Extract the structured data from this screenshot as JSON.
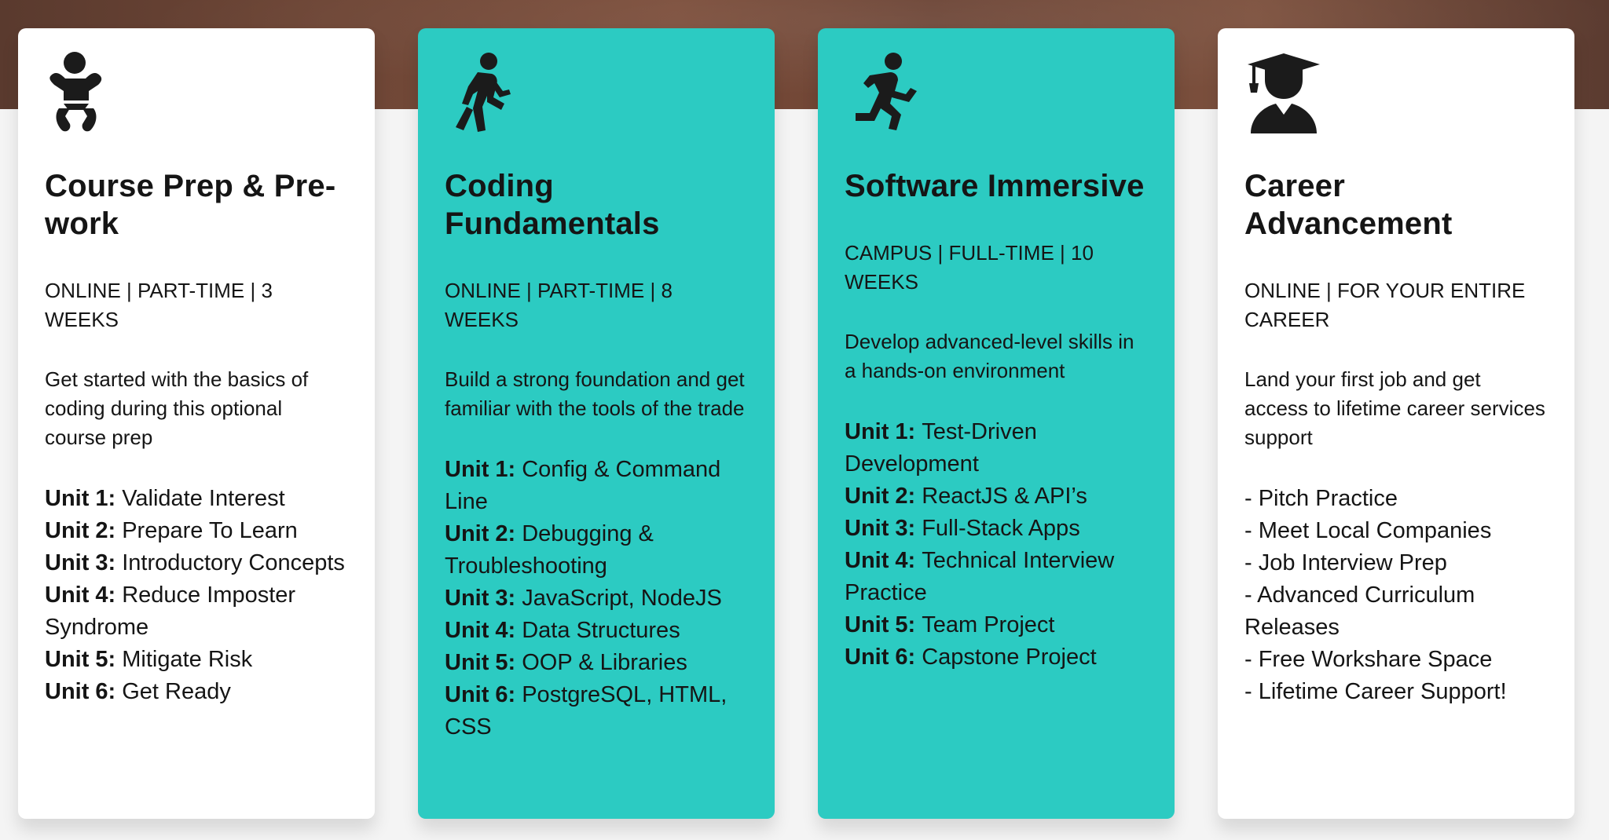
{
  "cards": [
    {
      "icon": "baby-icon",
      "title": "Course Prep & Pre-work",
      "meta": "ONLINE | PART-TIME | 3 WEEKS",
      "description": "Get started with the basics of coding during this optional course prep",
      "units": [
        {
          "label": "Unit 1:",
          "text": "Validate Interest"
        },
        {
          "label": "Unit 2:",
          "text": "Prepare To Learn"
        },
        {
          "label": "Unit 3:",
          "text": "Introductory Concepts"
        },
        {
          "label": "Unit 4:",
          "text": "Reduce Imposter Syndrome"
        },
        {
          "label": "Unit 5:",
          "text": "Mitigate Risk"
        },
        {
          "label": "Unit 6:",
          "text": "Get Ready"
        }
      ]
    },
    {
      "icon": "walking-icon",
      "title": "Coding Fundamentals",
      "meta": "ONLINE | PART-TIME | 8 WEEKS",
      "description": "Build a strong foundation and get familiar with the tools of the trade",
      "units": [
        {
          "label": "Unit 1:",
          "text": "Config & Command Line"
        },
        {
          "label": "Unit 2:",
          "text": "Debugging & Troubleshooting"
        },
        {
          "label": "Unit 3:",
          "text": "JavaScript, NodeJS"
        },
        {
          "label": "Unit 4:",
          "text": "Data Structures"
        },
        {
          "label": "Unit 5:",
          "text": "OOP & Libraries"
        },
        {
          "label": "Unit 6:",
          "text": "PostgreSQL, HTML, CSS"
        }
      ]
    },
    {
      "icon": "running-icon",
      "title": "Software Immersive",
      "meta": "CAMPUS | FULL-TIME | 10 WEEKS",
      "description": "Develop advanced-level skills in a hands-on environment",
      "units": [
        {
          "label": "Unit 1:",
          "text": "Test-Driven Development"
        },
        {
          "label": "Unit 2:",
          "text": "ReactJS & API’s"
        },
        {
          "label": "Unit 3:",
          "text": "Full-Stack Apps"
        },
        {
          "label": "Unit 4:",
          "text": "Technical Interview Practice"
        },
        {
          "label": "Unit 5:",
          "text": "Team Project"
        },
        {
          "label": "Unit 6:",
          "text": "Capstone Project"
        }
      ]
    },
    {
      "icon": "graduate-icon",
      "title": "Career Advancement",
      "meta": "ONLINE | FOR YOUR ENTIRE CAREER",
      "description": "Land your first job and get access to lifetime career services support",
      "bullets": [
        "- Pitch Practice",
        "- Meet Local Companies",
        "- Job Interview Prep",
        "- Advanced Curriculum Releases",
        "- Free Workshare Space",
        "- Lifetime Career Support!"
      ]
    }
  ]
}
